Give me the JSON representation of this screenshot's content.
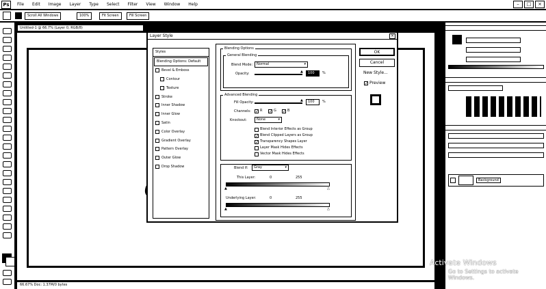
{
  "menu": {
    "logo": "Ps",
    "items": [
      "File",
      "Edit",
      "Image",
      "Layer",
      "Type",
      "Select",
      "Filter",
      "View",
      "Window",
      "Help"
    ]
  },
  "optionsbar": {
    "scroll_all": "Scroll All Windows",
    "btn1": "100%",
    "btn2": "Fit Screen",
    "btn3": "Fill Screen"
  },
  "document": {
    "tab": "Untitled-1 @ 66.7% (Layer 0, RGB/8)",
    "canvas_text": "e",
    "status": "66.67%   Doc: 1.37M/0 bytes"
  },
  "dialog": {
    "title": "Layer Style",
    "close": "×",
    "styles_header": "Styles",
    "styles": [
      {
        "label": "Blending Options: Default",
        "checkbox": false,
        "selected": true,
        "indent": false
      },
      {
        "label": "Bevel & Emboss",
        "checkbox": true,
        "checked": false,
        "indent": false
      },
      {
        "label": "Contour",
        "checkbox": true,
        "checked": false,
        "indent": true
      },
      {
        "label": "Texture",
        "checkbox": true,
        "checked": false,
        "indent": true
      },
      {
        "label": "Stroke",
        "checkbox": true,
        "checked": false,
        "indent": false
      },
      {
        "label": "Inner Shadow",
        "checkbox": true,
        "checked": false,
        "indent": false
      },
      {
        "label": "Inner Glow",
        "checkbox": true,
        "checked": false,
        "indent": false
      },
      {
        "label": "Satin",
        "checkbox": true,
        "checked": false,
        "indent": false
      },
      {
        "label": "Color Overlay",
        "checkbox": true,
        "checked": false,
        "indent": false
      },
      {
        "label": "Gradient Overlay",
        "checkbox": true,
        "checked": false,
        "indent": false
      },
      {
        "label": "Pattern Overlay",
        "checkbox": true,
        "checked": false,
        "indent": false
      },
      {
        "label": "Outer Glow",
        "checkbox": true,
        "checked": false,
        "indent": false
      },
      {
        "label": "Drop Shadow",
        "checkbox": true,
        "checked": false,
        "indent": false
      }
    ],
    "blending_options": "Blending Options",
    "general_blending": "General Blending",
    "blend_mode_label": "Blend Mode:",
    "blend_mode_value": "Normal",
    "opacity_label": "Opacity:",
    "opacity_value": "100",
    "pct": "%",
    "advanced_blending": "Advanced Blending",
    "fill_opacity_label": "Fill Opacity:",
    "fill_opacity_value": "100",
    "channels_label": "Channels:",
    "channel_r": "R",
    "channel_g": "G",
    "channel_b": "B",
    "knockout_label": "Knockout:",
    "knockout_value": "None",
    "options": [
      {
        "label": "Blend Interior Effects as Group",
        "checked": false
      },
      {
        "label": "Blend Clipped Layers as Group",
        "checked": true
      },
      {
        "label": "Transparency Shapes Layer",
        "checked": true
      },
      {
        "label": "Layer Mask Hides Effects",
        "checked": false
      },
      {
        "label": "Vector Mask Hides Effects",
        "checked": false
      }
    ],
    "blend_if_label": "Blend If:",
    "blend_if_value": "Gray",
    "this_layer": "This Layer:",
    "this_layer_min": "0",
    "this_layer_max": "255",
    "underlying_layer": "Underlying Layer:",
    "underlying_min": "0",
    "underlying_max": "255",
    "ok": "OK",
    "cancel": "Cancel",
    "new_style": "New Style...",
    "preview": "Preview"
  },
  "layers_panel": {
    "layer_name": "Background"
  },
  "watermark": {
    "line1": "Activate Windows",
    "line2": "Go to Settings to activate Windows."
  }
}
